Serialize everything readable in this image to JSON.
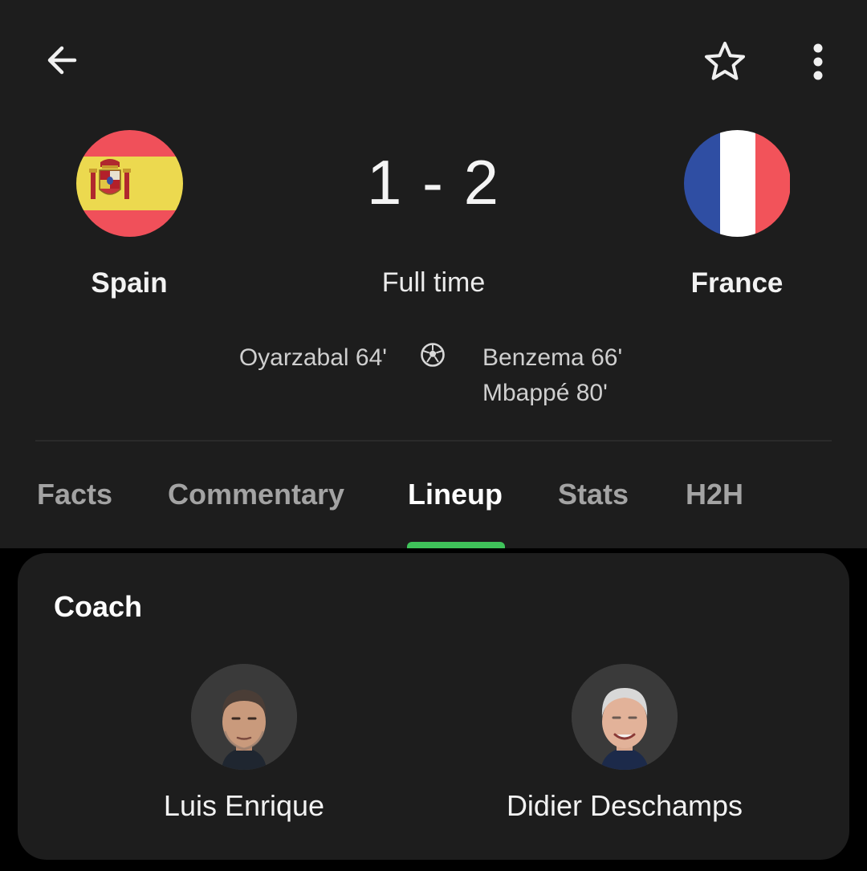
{
  "toolbar": {
    "back_icon": "arrow-left-icon",
    "favorite_icon": "star-outline-icon",
    "more_icon": "more-vert-icon"
  },
  "match": {
    "home": {
      "name": "Spain",
      "flag_icon": "spain-flag-icon"
    },
    "away": {
      "name": "France",
      "flag_icon": "france-flag-icon"
    },
    "score": "1 - 2",
    "status": "Full time",
    "goal_icon": "soccer-ball-icon",
    "home_scorers": [
      "Oyarzabal 64'"
    ],
    "away_scorers": [
      "Benzema 66'",
      "Mbappé 80'"
    ]
  },
  "tabs": [
    {
      "label": "Facts",
      "active": false
    },
    {
      "label": "Commentary",
      "active": false
    },
    {
      "label": "Lineup",
      "active": true
    },
    {
      "label": "Stats",
      "active": false
    },
    {
      "label": "H2H",
      "active": false
    }
  ],
  "coach_card": {
    "title": "Coach",
    "coaches": [
      {
        "name": "Luis Enrique",
        "avatar": "coach-photo"
      },
      {
        "name": "Didier Deschamps",
        "avatar": "coach-photo"
      }
    ]
  },
  "colors": {
    "background": "#1d1d1d",
    "accent": "#3fc35a"
  }
}
